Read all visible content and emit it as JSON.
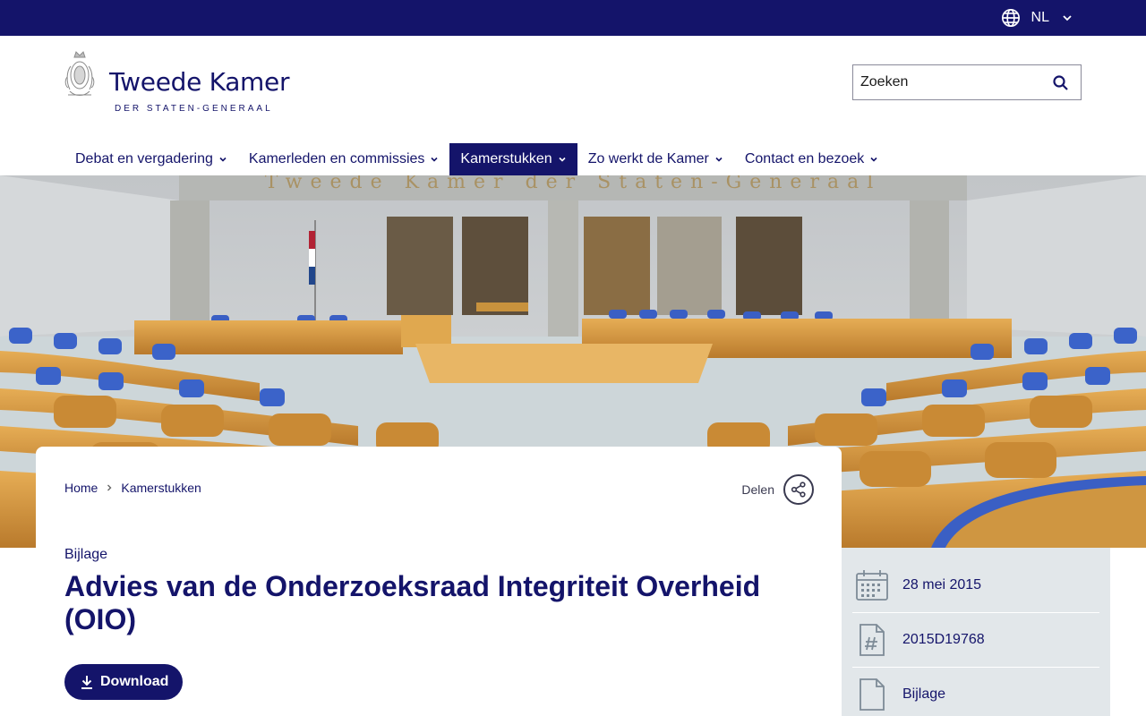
{
  "topbar": {
    "language": "NL"
  },
  "header": {
    "logo_title": "Tweede Kamer",
    "logo_subtitle": "DER STATEN-GENERAAL",
    "search_placeholder": "Zoeken"
  },
  "nav": {
    "items": [
      {
        "label": "Debat en vergadering",
        "active": false
      },
      {
        "label": "Kamerleden en commissies",
        "active": false
      },
      {
        "label": "Kamerstukken",
        "active": true
      },
      {
        "label": "Zo werkt de Kamer",
        "active": false
      },
      {
        "label": "Contact en bezoek",
        "active": false
      }
    ]
  },
  "hero": {
    "wall_inscription": "Tweede Kamer der Staten-Generaal"
  },
  "breadcrumb": [
    "Home",
    "Kamerstukken"
  ],
  "share_label": "Delen",
  "document": {
    "type": "Bijlage",
    "title": "Advies van de Onderzoeksraad Integriteit Overheid (OIO)",
    "download_label": "Download"
  },
  "meta": [
    {
      "icon": "calendar-icon",
      "value": "28 mei 2015"
    },
    {
      "icon": "hash-document-icon",
      "value": "2015D19768"
    },
    {
      "icon": "document-icon",
      "value": "Bijlage"
    }
  ],
  "colors": {
    "brand_navy": "#14146a",
    "meta_background": "#e2e7ea",
    "seat_blue": "#3a5fc4",
    "wood": "#d99a3c"
  }
}
